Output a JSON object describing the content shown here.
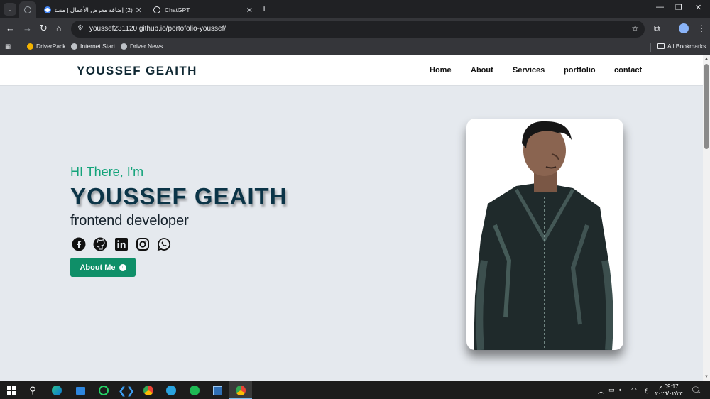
{
  "browser": {
    "tabs": [
      {
        "title": "(2) إضافة معرض الأعمال | مستقل",
        "favicon_color": "#4285f4"
      },
      {
        "title": "ChatGPT",
        "favicon_color": "#e8eaed"
      }
    ],
    "address": "youssef231120.github.io/portofolio-youssef/",
    "bookmarks": [
      {
        "label": "DriverPack"
      },
      {
        "label": "Internet Start"
      },
      {
        "label": "Driver News"
      }
    ],
    "all_bookmarks": "All Bookmarks"
  },
  "site": {
    "logo": "YOUSSEF GEAITH",
    "nav": [
      "Home",
      "About",
      "Services",
      "portfolio",
      "contact"
    ],
    "hero": {
      "greeting": "HI There, I'm",
      "name": "YOUSSEF GEAITH",
      "role": "frontend developer",
      "socials": [
        "facebook-icon",
        "github-icon",
        "linkedin-icon",
        "instagram-icon",
        "whatsapp-icon"
      ],
      "button_label": "About Me"
    },
    "colors": {
      "accent": "#13a37a",
      "button": "#0f8f68",
      "name": "#0b3447",
      "background": "#e5e9ee"
    }
  },
  "taskbar": {
    "tray_lang": "ع",
    "time": "09:17 م",
    "date": "٢٠٢٦/٠٢/٢٣",
    "notifications": "1"
  }
}
